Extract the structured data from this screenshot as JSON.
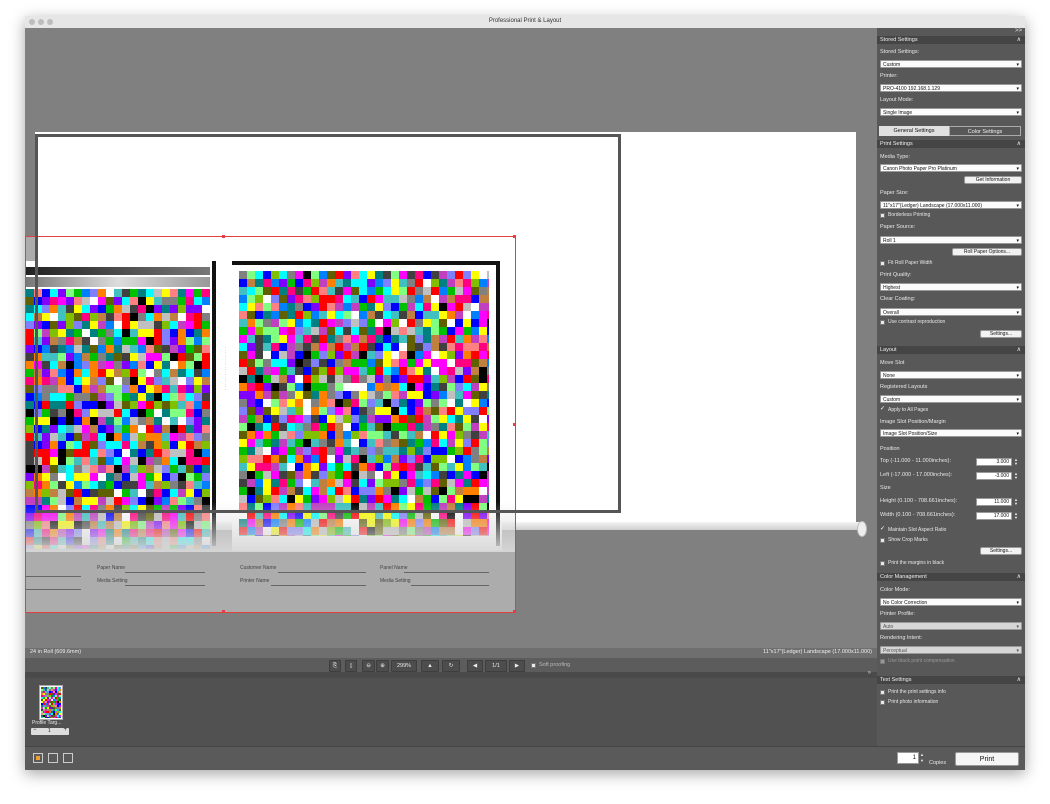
{
  "window": {
    "title": "Professional Print & Layout"
  },
  "panel": {
    "collapse_glyph": ">>",
    "stored": {
      "header": "Stored Settings",
      "label": "Stored Settings:",
      "value": "Custom",
      "printer_label": "Printer:",
      "printer_value": "PRO-4100 192.168.1.129",
      "layout_mode_label": "Layout Mode:",
      "layout_mode_value": "Single Image"
    },
    "tabs": [
      "General Settings",
      "Color Settings"
    ],
    "print_settings": {
      "header": "Print Settings",
      "media_type_label": "Media Type:",
      "media_type_value": "Canon Photo Paper Pro Platinum",
      "get_info": "Get Information",
      "paper_size_label": "Paper Size:",
      "paper_size_value": "11\"x17\"(Ledger) Landscape (17.000x11.000)",
      "borderless": "Borderless Printing",
      "paper_source_label": "Paper Source:",
      "paper_source_value": "Roll 1",
      "roll_options": "Roll Paper Options...",
      "fit_roll": "Fit Roll Paper Width",
      "quality_label": "Print Quality:",
      "quality_value": "Highest",
      "clear_label": "Clear Coating:",
      "clear_value": "Overall",
      "contrast": "Use contrast reproduction",
      "settings_btn": "Settings..."
    },
    "layout": {
      "header": "Layout",
      "move_slot_label": "Move Slot",
      "move_slot_value": "None",
      "registered_label": "Registered Layouts",
      "registered_value": "Custom",
      "apply_all": "Apply to All Pages",
      "slot_label": "Image Slot Position/Margin",
      "slot_value": "Image Slot Position/Size",
      "position_label": "Position",
      "top_label": "Top (-11.000 - 11.000inches):",
      "top_value": "3.000",
      "left_label": "Left (-17.000 - 17.000inches):",
      "left_value": "-3.000",
      "size_label": "Size",
      "height_label": "Height (0.100 - 708.661inches):",
      "height_value": "11.000",
      "width_label": "Width (0.100 - 708.661inches):",
      "width_value": "17.000",
      "maintain": "Maintain Slot Aspect Ratio",
      "crop": "Show Crop Marks",
      "settings_btn": "Settings...",
      "margins_black": "Print the margins in black"
    },
    "color": {
      "header": "Color Management",
      "mode_label": "Color Mode:",
      "mode_value": "No Color Correction",
      "profile_label": "Printer Profile:",
      "profile_value": "Auto",
      "intent_label": "Rendering Intent:",
      "intent_value": "Perceptual",
      "bpc": "Use black point compensation"
    },
    "text": {
      "header": "Text Settings",
      "print_info": "Print the print settings info",
      "photo_info": "Print photo information"
    }
  },
  "status": {
    "left": "24 in Roll (609.6mm)",
    "right": "11\"x17\"(Ledger) Landscape (17.000x11.000)"
  },
  "toolbar": {
    "zoom": "299%",
    "page": "1/1",
    "soft_proof": "Soft proofing"
  },
  "sheet_fields": {
    "paper_name": "Paper Name",
    "media_setting": "Media Setting",
    "customer_name": "Customer Name",
    "printer_name": "Printer Name",
    "panel_name": "Panel Name"
  },
  "thumbnail": {
    "label": "Profile Targ...",
    "count": "1",
    "minus": "−",
    "plus": "+"
  },
  "bottom": {
    "copies_label": "Copies",
    "copies_value": "1",
    "print": "Print"
  },
  "colors": {
    "panel": "#585858",
    "section": "#454545",
    "canvas": "#808080",
    "layout_border": "#e04040"
  }
}
